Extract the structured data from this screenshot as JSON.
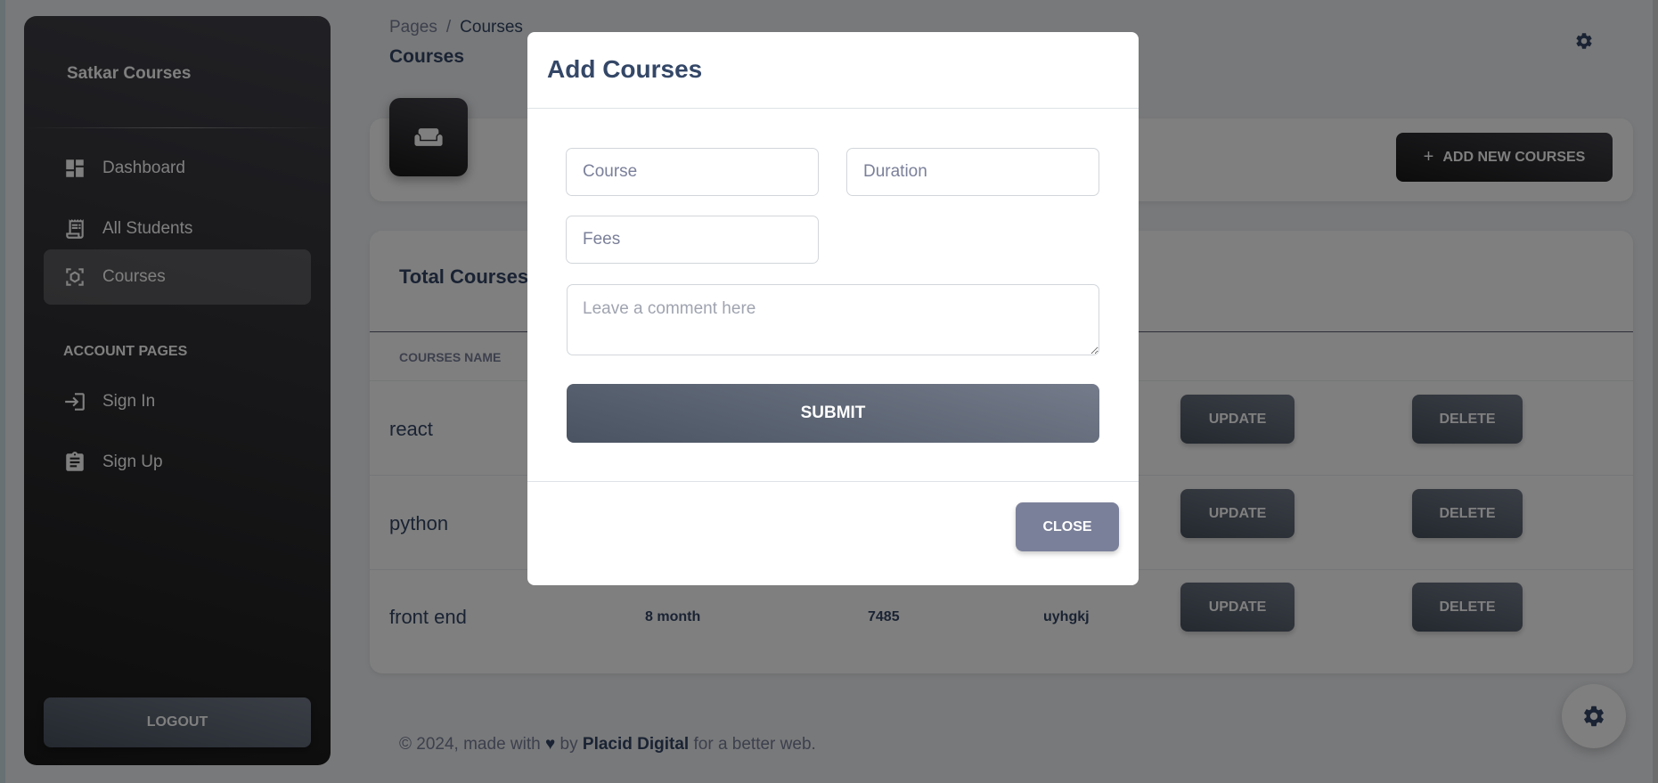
{
  "sidebar": {
    "brand": "Satkar Courses",
    "items": [
      {
        "label": "Dashboard",
        "icon": "dashboard-icon"
      },
      {
        "label": "All Students",
        "icon": "receipt-icon"
      },
      {
        "label": "Courses",
        "icon": "courses-icon",
        "active": true
      }
    ],
    "section_label": "ACCOUNT PAGES",
    "account_items": [
      {
        "label": "Sign In",
        "icon": "login-icon"
      },
      {
        "label": "Sign Up",
        "icon": "assignment-icon"
      }
    ],
    "logout_label": "LOGOUT"
  },
  "header": {
    "breadcrumb": {
      "parent": "Pages",
      "separator": "/",
      "current": "Courses"
    },
    "title": "Courses"
  },
  "toolbar": {
    "add_new_label": "ADD NEW COURSES",
    "add_new_icon": "plus"
  },
  "table": {
    "title": "Total Courses",
    "columns": [
      "COURSES NAME"
    ],
    "rows": [
      {
        "name": "react"
      },
      {
        "name": "python"
      },
      {
        "name": "front end",
        "duration": "8 month",
        "fees": "7485",
        "comment": "uyhgkj"
      }
    ],
    "update_label": "UPDATE",
    "delete_label": "DELETE"
  },
  "footer": {
    "prefix": "© 2024, made with",
    "heart": "♥",
    "by": "by",
    "company": "Placid Digital",
    "suffix": "for a better web."
  },
  "modal": {
    "title": "Add Courses",
    "course_placeholder": "Course",
    "duration_placeholder": "Duration",
    "fees_placeholder": "Fees",
    "comment_placeholder": "Leave a comment here",
    "submit_label": "SUBMIT",
    "close_label": "CLOSE"
  },
  "colors": {
    "sidebar_dark": "#191919",
    "text_primary": "#344767",
    "text_secondary": "#7b809a",
    "button_gray": "#495361"
  }
}
